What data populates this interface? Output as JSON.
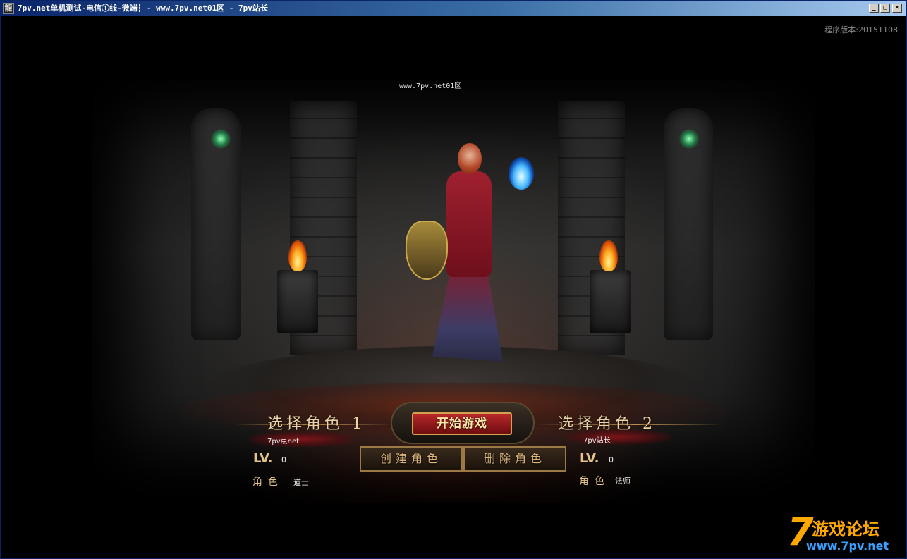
{
  "window": {
    "title": "7pv.net单机测试-电信①线-微端┇ - www.7pv.net01区 - 7pv站长",
    "app_icon_glyph": "龍",
    "minimize_glyph": "_",
    "maximize_glyph": "□",
    "close_glyph": "×"
  },
  "header": {
    "version": "程序版本:20151108",
    "server": "www.7pv.net01区"
  },
  "slot1": {
    "title": "选择角色 1",
    "name": "7pv点net",
    "lv_label": "LV.",
    "lv_value": "0",
    "role_label": "角色",
    "role_value": "道士"
  },
  "slot2": {
    "title": "选择角色 2",
    "name": "7pv站长",
    "lv_label": "LV.",
    "lv_value": "0",
    "role_label": "角色",
    "role_value": "法师"
  },
  "buttons": {
    "start": "开始游戏",
    "create": "创建角色",
    "delete": "删除角色"
  },
  "watermark": {
    "seven": "7",
    "text": "游戏论坛",
    "url": "www.7pv.net"
  },
  "colors": {
    "accent_gold": "#e3c38a",
    "start_red": "#b8282a",
    "logo_orange": "#ffa800",
    "logo_blue": "#3aa0ff"
  }
}
